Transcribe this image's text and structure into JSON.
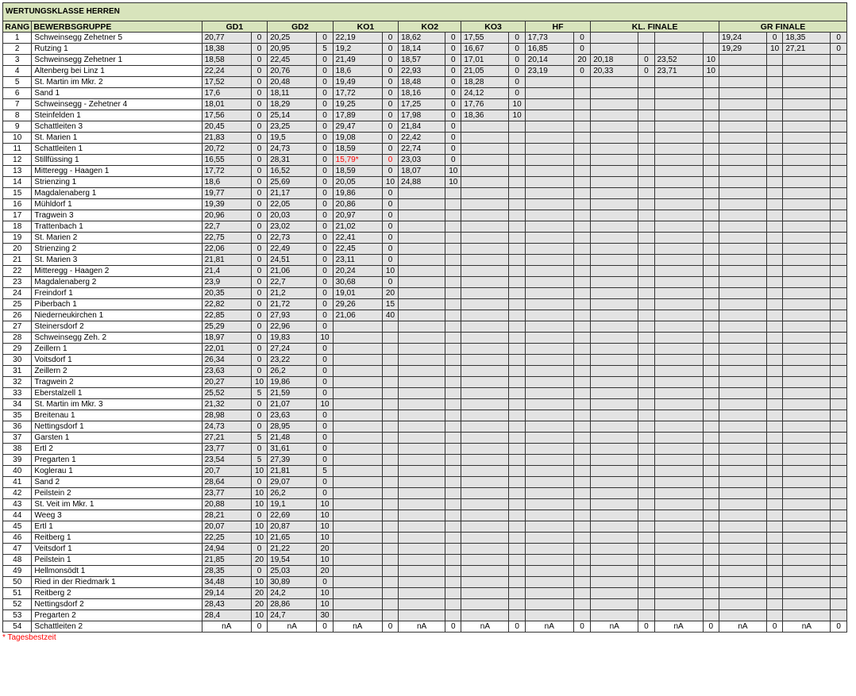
{
  "title": "WERTUNGSKLASSE HERREN",
  "headers": {
    "rang": "RANG",
    "gruppe": "BEWERBSGRUPPE",
    "rounds": [
      "GD1",
      "GD2",
      "KO1",
      "KO2",
      "KO3",
      "HF",
      "KL. FINALE",
      "GR FINALE"
    ]
  },
  "footnote": "* Tagesbestzeit",
  "highlight_color": "#ff0000",
  "rows": [
    {
      "rang": "1",
      "name": "Schweinsegg Zehetner 5",
      "cells": [
        "20,77",
        "0",
        "20,25",
        "0",
        "22,19",
        "0",
        "18,62",
        "0",
        "17,55",
        "0",
        "17,73",
        "0",
        "",
        "",
        "",
        "",
        "19,24",
        "0",
        "18,35",
        "0"
      ]
    },
    {
      "rang": "2",
      "name": "Rutzing 1",
      "cells": [
        "18,38",
        "0",
        "20,95",
        "5",
        "19,2",
        "0",
        "18,14",
        "0",
        "16,67",
        "0",
        "16,85",
        "0",
        "",
        "",
        "",
        "",
        "19,29",
        "10",
        "27,21",
        "0"
      ]
    },
    {
      "rang": "3",
      "name": "Schweinsegg Zehetner 1",
      "cells": [
        "18,58",
        "0",
        "22,45",
        "0",
        "21,49",
        "0",
        "18,57",
        "0",
        "17,01",
        "0",
        "20,14",
        "20",
        "20,18",
        "0",
        "23,52",
        "10",
        "",
        "",
        "",
        ""
      ]
    },
    {
      "rang": "4",
      "name": "Altenberg bei Linz 1",
      "cells": [
        "22,24",
        "0",
        "20,76",
        "0",
        "18,6",
        "0",
        "22,93",
        "0",
        "21,05",
        "0",
        "23,19",
        "0",
        "20,33",
        "0",
        "23,71",
        "10",
        "",
        "",
        "",
        ""
      ]
    },
    {
      "rang": "5",
      "name": "St. Martin im Mkr. 2",
      "cells": [
        "17,52",
        "0",
        "20,48",
        "0",
        "19,49",
        "0",
        "18,48",
        "0",
        "18,28",
        "0",
        "",
        "",
        "",
        "",
        "",
        "",
        "",
        "",
        "",
        ""
      ]
    },
    {
      "rang": "6",
      "name": "Sand 1",
      "cells": [
        "17,6",
        "0",
        "18,11",
        "0",
        "17,72",
        "0",
        "18,16",
        "0",
        "24,12",
        "0",
        "",
        "",
        "",
        "",
        "",
        "",
        "",
        "",
        "",
        ""
      ]
    },
    {
      "rang": "7",
      "name": "Schweinsegg - Zehetner 4",
      "cells": [
        "18,01",
        "0",
        "18,29",
        "0",
        "19,25",
        "0",
        "17,25",
        "0",
        "17,76",
        "10",
        "",
        "",
        "",
        "",
        "",
        "",
        "",
        "",
        "",
        ""
      ]
    },
    {
      "rang": "8",
      "name": "Steinfelden 1",
      "cells": [
        "17,56",
        "0",
        "25,14",
        "0",
        "17,89",
        "0",
        "17,98",
        "0",
        "18,36",
        "10",
        "",
        "",
        "",
        "",
        "",
        "",
        "",
        "",
        "",
        ""
      ]
    },
    {
      "rang": "9",
      "name": "Schattleiten 3",
      "cells": [
        "20,45",
        "0",
        "23,25",
        "0",
        "29,47",
        "0",
        "21,84",
        "0",
        "",
        "",
        "",
        "",
        "",
        "",
        "",
        "",
        "",
        "",
        "",
        ""
      ]
    },
    {
      "rang": "10",
      "name": "St. Marien 1",
      "cells": [
        "21,83",
        "0",
        "19,5",
        "0",
        "19,08",
        "0",
        "22,42",
        "0",
        "",
        "",
        "",
        "",
        "",
        "",
        "",
        "",
        "",
        "",
        "",
        ""
      ]
    },
    {
      "rang": "11",
      "name": "Schattleiten 1",
      "cells": [
        "20,72",
        "0",
        "24,73",
        "0",
        "18,59",
        "0",
        "22,74",
        "0",
        "",
        "",
        "",
        "",
        "",
        "",
        "",
        "",
        "",
        "",
        "",
        ""
      ]
    },
    {
      "rang": "12",
      "name": "Stillfüssing 1",
      "cells": [
        "16,55",
        "0",
        "28,31",
        "0",
        "15,79*",
        "0",
        "23,03",
        "0",
        "",
        "",
        "",
        "",
        "",
        "",
        "",
        "",
        "",
        "",
        "",
        ""
      ]
    },
    {
      "rang": "13",
      "name": "Mitteregg - Haagen 1",
      "cells": [
        "17,72",
        "0",
        "16,52",
        "0",
        "18,59",
        "0",
        "18,07",
        "10",
        "",
        "",
        "",
        "",
        "",
        "",
        "",
        "",
        "",
        "",
        "",
        ""
      ]
    },
    {
      "rang": "14",
      "name": "Strienzing 1",
      "cells": [
        "18,6",
        "0",
        "25,69",
        "0",
        "20,05",
        "10",
        "24,88",
        "10",
        "",
        "",
        "",
        "",
        "",
        "",
        "",
        "",
        "",
        "",
        "",
        ""
      ]
    },
    {
      "rang": "15",
      "name": "Magdalenaberg 1",
      "cells": [
        "19,77",
        "0",
        "21,17",
        "0",
        "19,86",
        "0",
        "",
        "",
        "",
        "",
        "",
        "",
        "",
        "",
        "",
        "",
        "",
        "",
        "",
        ""
      ]
    },
    {
      "rang": "16",
      "name": "Mühldorf 1",
      "cells": [
        "19,39",
        "0",
        "22,05",
        "0",
        "20,86",
        "0",
        "",
        "",
        "",
        "",
        "",
        "",
        "",
        "",
        "",
        "",
        "",
        "",
        "",
        ""
      ]
    },
    {
      "rang": "17",
      "name": "Tragwein 3",
      "cells": [
        "20,96",
        "0",
        "20,03",
        "0",
        "20,97",
        "0",
        "",
        "",
        "",
        "",
        "",
        "",
        "",
        "",
        "",
        "",
        "",
        "",
        "",
        ""
      ]
    },
    {
      "rang": "18",
      "name": "Trattenbach 1",
      "cells": [
        "22,7",
        "0",
        "23,02",
        "0",
        "21,02",
        "0",
        "",
        "",
        "",
        "",
        "",
        "",
        "",
        "",
        "",
        "",
        "",
        "",
        "",
        ""
      ]
    },
    {
      "rang": "19",
      "name": "St. Marien 2",
      "cells": [
        "22,75",
        "0",
        "22,73",
        "0",
        "22,41",
        "0",
        "",
        "",
        "",
        "",
        "",
        "",
        "",
        "",
        "",
        "",
        "",
        "",
        "",
        ""
      ]
    },
    {
      "rang": "20",
      "name": "Strienzing 2",
      "cells": [
        "22,06",
        "0",
        "22,49",
        "0",
        "22,45",
        "0",
        "",
        "",
        "",
        "",
        "",
        "",
        "",
        "",
        "",
        "",
        "",
        "",
        "",
        ""
      ]
    },
    {
      "rang": "21",
      "name": "St. Marien 3",
      "cells": [
        "21,81",
        "0",
        "24,51",
        "0",
        "23,11",
        "0",
        "",
        "",
        "",
        "",
        "",
        "",
        "",
        "",
        "",
        "",
        "",
        "",
        "",
        ""
      ]
    },
    {
      "rang": "22",
      "name": "Mitteregg - Haagen 2",
      "cells": [
        "21,4",
        "0",
        "21,06",
        "0",
        "20,24",
        "10",
        "",
        "",
        "",
        "",
        "",
        "",
        "",
        "",
        "",
        "",
        "",
        "",
        "",
        ""
      ]
    },
    {
      "rang": "23",
      "name": "Magdalenaberg 2",
      "cells": [
        "23,9",
        "0",
        "22,7",
        "0",
        "30,68",
        "0",
        "",
        "",
        "",
        "",
        "",
        "",
        "",
        "",
        "",
        "",
        "",
        "",
        "",
        ""
      ]
    },
    {
      "rang": "24",
      "name": "Freindorf 1",
      "cells": [
        "20,35",
        "0",
        "21,2",
        "0",
        "19,01",
        "20",
        "",
        "",
        "",
        "",
        "",
        "",
        "",
        "",
        "",
        "",
        "",
        "",
        "",
        ""
      ]
    },
    {
      "rang": "25",
      "name": "Piberbach 1",
      "cells": [
        "22,82",
        "0",
        "21,72",
        "0",
        "29,26",
        "15",
        "",
        "",
        "",
        "",
        "",
        "",
        "",
        "",
        "",
        "",
        "",
        "",
        "",
        ""
      ]
    },
    {
      "rang": "26",
      "name": "Niederneukirchen 1",
      "cells": [
        "22,85",
        "0",
        "27,93",
        "0",
        "21,06",
        "40",
        "",
        "",
        "",
        "",
        "",
        "",
        "",
        "",
        "",
        "",
        "",
        "",
        "",
        ""
      ]
    },
    {
      "rang": "27",
      "name": "Steinersdorf 2",
      "cells": [
        "25,29",
        "0",
        "22,96",
        "0",
        "",
        "",
        "",
        "",
        "",
        "",
        "",
        "",
        "",
        "",
        "",
        "",
        "",
        "",
        "",
        ""
      ]
    },
    {
      "rang": "28",
      "name": "Schweinsegg Zeh. 2",
      "cells": [
        "18,97",
        "0",
        "19,83",
        "10",
        "",
        "",
        "",
        "",
        "",
        "",
        "",
        "",
        "",
        "",
        "",
        "",
        "",
        "",
        "",
        ""
      ]
    },
    {
      "rang": "29",
      "name": "Zeillern 1",
      "cells": [
        "22,01",
        "0",
        "27,24",
        "0",
        "",
        "",
        "",
        "",
        "",
        "",
        "",
        "",
        "",
        "",
        "",
        "",
        "",
        "",
        "",
        ""
      ]
    },
    {
      "rang": "30",
      "name": "Voitsdorf 1",
      "cells": [
        "26,34",
        "0",
        "23,22",
        "0",
        "",
        "",
        "",
        "",
        "",
        "",
        "",
        "",
        "",
        "",
        "",
        "",
        "",
        "",
        "",
        ""
      ]
    },
    {
      "rang": "31",
      "name": "Zeillern 2",
      "cells": [
        "23,63",
        "0",
        "26,2",
        "0",
        "",
        "",
        "",
        "",
        "",
        "",
        "",
        "",
        "",
        "",
        "",
        "",
        "",
        "",
        "",
        ""
      ]
    },
    {
      "rang": "32",
      "name": "Tragwein 2",
      "cells": [
        "20,27",
        "10",
        "19,86",
        "0",
        "",
        "",
        "",
        "",
        "",
        "",
        "",
        "",
        "",
        "",
        "",
        "",
        "",
        "",
        "",
        ""
      ]
    },
    {
      "rang": "33",
      "name": "Eberstalzell 1",
      "cells": [
        "25,52",
        "5",
        "21,59",
        "0",
        "",
        "",
        "",
        "",
        "",
        "",
        "",
        "",
        "",
        "",
        "",
        "",
        "",
        "",
        "",
        ""
      ]
    },
    {
      "rang": "34",
      "name": "St. Martin im Mkr. 3",
      "cells": [
        "21,32",
        "0",
        "21,07",
        "10",
        "",
        "",
        "",
        "",
        "",
        "",
        "",
        "",
        "",
        "",
        "",
        "",
        "",
        "",
        "",
        ""
      ]
    },
    {
      "rang": "35",
      "name": "Breitenau 1",
      "cells": [
        "28,98",
        "0",
        "23,63",
        "0",
        "",
        "",
        "",
        "",
        "",
        "",
        "",
        "",
        "",
        "",
        "",
        "",
        "",
        "",
        "",
        ""
      ]
    },
    {
      "rang": "36",
      "name": "Nettingsdorf 1",
      "cells": [
        "24,73",
        "0",
        "28,95",
        "0",
        "",
        "",
        "",
        "",
        "",
        "",
        "",
        "",
        "",
        "",
        "",
        "",
        "",
        "",
        "",
        ""
      ]
    },
    {
      "rang": "37",
      "name": "Garsten 1",
      "cells": [
        "27,21",
        "5",
        "21,48",
        "0",
        "",
        "",
        "",
        "",
        "",
        "",
        "",
        "",
        "",
        "",
        "",
        "",
        "",
        "",
        "",
        ""
      ]
    },
    {
      "rang": "38",
      "name": "Ertl 2",
      "cells": [
        "23,77",
        "0",
        "31,61",
        "0",
        "",
        "",
        "",
        "",
        "",
        "",
        "",
        "",
        "",
        "",
        "",
        "",
        "",
        "",
        "",
        ""
      ]
    },
    {
      "rang": "39",
      "name": "Pregarten 1",
      "cells": [
        "23,54",
        "5",
        "27,39",
        "0",
        "",
        "",
        "",
        "",
        "",
        "",
        "",
        "",
        "",
        "",
        "",
        "",
        "",
        "",
        "",
        ""
      ]
    },
    {
      "rang": "40",
      "name": "Koglerau 1",
      "cells": [
        "20,7",
        "10",
        "21,81",
        "5",
        "",
        "",
        "",
        "",
        "",
        "",
        "",
        "",
        "",
        "",
        "",
        "",
        "",
        "",
        "",
        ""
      ]
    },
    {
      "rang": "41",
      "name": "Sand 2",
      "cells": [
        "28,64",
        "0",
        "29,07",
        "0",
        "",
        "",
        "",
        "",
        "",
        "",
        "",
        "",
        "",
        "",
        "",
        "",
        "",
        "",
        "",
        ""
      ]
    },
    {
      "rang": "42",
      "name": "Peilstein 2",
      "cells": [
        "23,77",
        "10",
        "26,2",
        "0",
        "",
        "",
        "",
        "",
        "",
        "",
        "",
        "",
        "",
        "",
        "",
        "",
        "",
        "",
        "",
        ""
      ]
    },
    {
      "rang": "43",
      "name": "St. Veit im Mkr. 1",
      "cells": [
        "20,88",
        "10",
        "19,1",
        "10",
        "",
        "",
        "",
        "",
        "",
        "",
        "",
        "",
        "",
        "",
        "",
        "",
        "",
        "",
        "",
        ""
      ]
    },
    {
      "rang": "44",
      "name": "Weeg 3",
      "cells": [
        "28,21",
        "0",
        "22,69",
        "10",
        "",
        "",
        "",
        "",
        "",
        "",
        "",
        "",
        "",
        "",
        "",
        "",
        "",
        "",
        "",
        ""
      ]
    },
    {
      "rang": "45",
      "name": "Ertl 1",
      "cells": [
        "20,07",
        "10",
        "20,87",
        "10",
        "",
        "",
        "",
        "",
        "",
        "",
        "",
        "",
        "",
        "",
        "",
        "",
        "",
        "",
        "",
        ""
      ]
    },
    {
      "rang": "46",
      "name": "Reitberg 1",
      "cells": [
        "22,25",
        "10",
        "21,65",
        "10",
        "",
        "",
        "",
        "",
        "",
        "",
        "",
        "",
        "",
        "",
        "",
        "",
        "",
        "",
        "",
        ""
      ]
    },
    {
      "rang": "47",
      "name": "Veitsdorf 1",
      "cells": [
        "24,94",
        "0",
        "21,22",
        "20",
        "",
        "",
        "",
        "",
        "",
        "",
        "",
        "",
        "",
        "",
        "",
        "",
        "",
        "",
        "",
        ""
      ]
    },
    {
      "rang": "48",
      "name": "Peilstein 1",
      "cells": [
        "21,85",
        "20",
        "19,54",
        "10",
        "",
        "",
        "",
        "",
        "",
        "",
        "",
        "",
        "",
        "",
        "",
        "",
        "",
        "",
        "",
        ""
      ]
    },
    {
      "rang": "49",
      "name": "Hellmonsödt 1",
      "cells": [
        "28,35",
        "0",
        "25,03",
        "20",
        "",
        "",
        "",
        "",
        "",
        "",
        "",
        "",
        "",
        "",
        "",
        "",
        "",
        "",
        "",
        ""
      ]
    },
    {
      "rang": "50",
      "name": "Ried in der Riedmark 1",
      "cells": [
        "34,48",
        "10",
        "30,89",
        "0",
        "",
        "",
        "",
        "",
        "",
        "",
        "",
        "",
        "",
        "",
        "",
        "",
        "",
        "",
        "",
        ""
      ]
    },
    {
      "rang": "51",
      "name": "Reitberg 2",
      "cells": [
        "29,14",
        "20",
        "24,2",
        "10",
        "",
        "",
        "",
        "",
        "",
        "",
        "",
        "",
        "",
        "",
        "",
        "",
        "",
        "",
        "",
        ""
      ]
    },
    {
      "rang": "52",
      "name": "Nettingsdorf 2",
      "cells": [
        "28,43",
        "20",
        "28,86",
        "10",
        "",
        "",
        "",
        "",
        "",
        "",
        "",
        "",
        "",
        "",
        "",
        "",
        "",
        "",
        "",
        ""
      ]
    },
    {
      "rang": "53",
      "name": "Pregarten 2",
      "cells": [
        "28,4",
        "10",
        "24,7",
        "30",
        "",
        "",
        "",
        "",
        "",
        "",
        "",
        "",
        "",
        "",
        "",
        "",
        "",
        "",
        "",
        ""
      ]
    },
    {
      "rang": "54",
      "name": "Schattleiten 2",
      "cells": [
        "nA",
        "0",
        "nA",
        "0",
        "nA",
        "0",
        "nA",
        "0",
        "nA",
        "0",
        "nA",
        "0",
        "nA",
        "0",
        "nA",
        "0",
        "nA",
        "0",
        "nA",
        "0"
      ]
    }
  ]
}
